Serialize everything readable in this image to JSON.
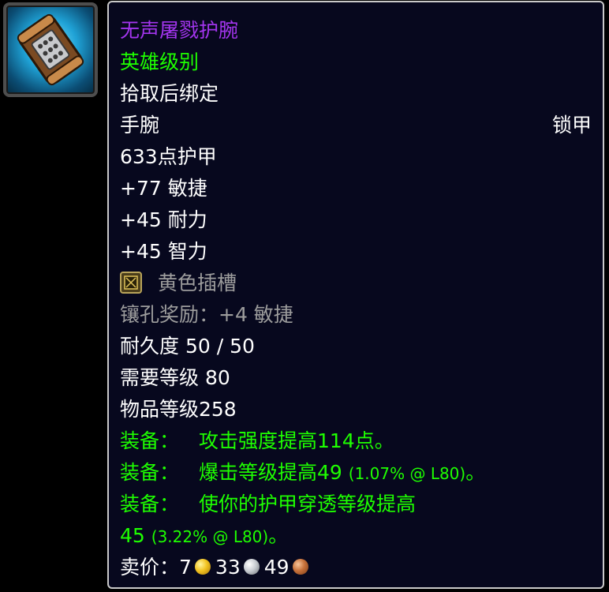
{
  "item": {
    "name": "无声屠戮护腕",
    "quality": "英雄级别",
    "binding": "拾取后绑定",
    "slot": "手腕",
    "armor_type": "锁甲",
    "armor": "633点护甲",
    "stats": [
      "+77 敏捷",
      "+45 耐力",
      "+45 智力"
    ],
    "socket": "黄色插槽",
    "socket_bonus": "镶孔奖励：+4 敏捷",
    "durability": "耐久度 50 / 50",
    "required_level": "需要等级 80",
    "item_level": "物品等级258",
    "equip_effects": [
      {
        "label": "装备：",
        "text": "攻击强度提高114点。"
      },
      {
        "label": "装备：",
        "text": "爆击等级提高49",
        "detail": "(1.07% @ L80)",
        "suffix": "。"
      },
      {
        "label": "装备：",
        "text": "使你的护甲穿透等级提高",
        "text2": "45",
        "detail": "(3.22% @ L80)",
        "suffix": "。"
      }
    ],
    "sell_price": {
      "label": "卖价：",
      "gold": "7",
      "silver": "33",
      "copper": "49"
    }
  },
  "icons": {
    "item_icon": "bracer-icon",
    "socket_icon": "yellow-socket-icon",
    "gold": "gold-coin-icon",
    "silver": "silver-coin-icon",
    "copper": "copper-coin-icon"
  },
  "colors": {
    "epic": "#a335ee",
    "uncommon_green": "#1eff00",
    "gray": "#9d9d9d",
    "white": "#ffffff",
    "tooltip_bg": "#07081e",
    "tooltip_border": "#c9c9c9"
  }
}
